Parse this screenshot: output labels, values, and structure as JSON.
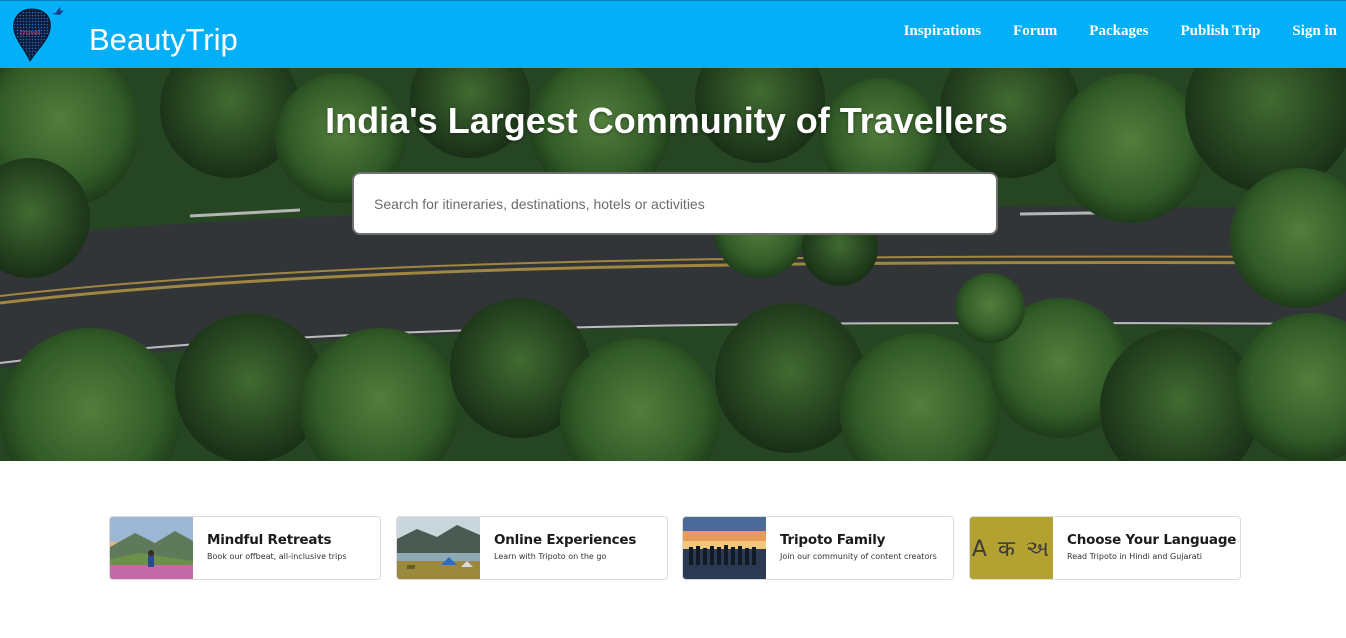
{
  "navbar": {
    "brand": "BeautyTrip",
    "links": [
      "Inspirations",
      "Forum",
      "Packages",
      "Publish Trip",
      "Sign in"
    ],
    "bg_color": "#03b0f7"
  },
  "hero": {
    "title": "India's Largest Community of Travellers",
    "search_placeholder": "Search for itineraries, destinations, hotels or activities"
  },
  "cards": [
    {
      "title": "Mindful Retreats",
      "subtitle": "Book our offbeat, all-inclusive trips",
      "thumb": "mountain-retreat-photo"
    },
    {
      "title": "Online Experiences",
      "subtitle": "Learn with Tripoto on the go",
      "thumb": "camping-lake-photo"
    },
    {
      "title": "Tripoto Family",
      "subtitle": "Join our community of content creators",
      "thumb": "sunset-group-photo"
    },
    {
      "title": "Choose Your Language",
      "subtitle": "Read Tripoto in Hindi and Gujarati",
      "thumb_text": "A क અ"
    }
  ]
}
